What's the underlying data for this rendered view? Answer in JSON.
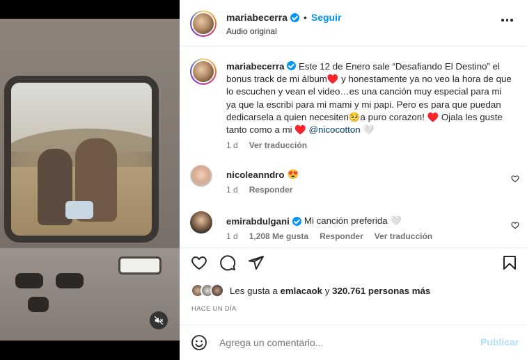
{
  "header": {
    "username": "mariabecerra",
    "separator": "•",
    "follow_label": "Seguir",
    "subtitle": "Audio original"
  },
  "caption": {
    "username": "mariabecerra",
    "text_1": "Este 12 de Enero sale “Desafiando El Destino” el bonus track de mi álbum♥️ y honestamente ya no veo la hora de que lo escuchen y vean el video…es una canción muy especial para mi ya que la escribi para mi mami y mi papi. Pero es para que puedan dedicarsela a quien necesiten🥺a puro corazon! ♥️ Ojala les guste tanto como a mi ♥️ ",
    "mention": "@nicocotton",
    "text_2": " 🤍",
    "time": "1 d",
    "translate_label": "Ver traducción"
  },
  "comments": [
    {
      "username": "nicoleanndro",
      "text": "😍",
      "time": "1 d",
      "reply_label": "Responder"
    },
    {
      "username": "emirabdulgani",
      "text": "Mi canción preferida 🤍",
      "time": "1 d",
      "likes": "1,208 Me gusta",
      "reply_label": "Responder",
      "translate_label": "Ver traducción"
    }
  ],
  "likes": {
    "prefix": "Les gusta a ",
    "user": "emlacaok",
    "middle": " y ",
    "count": "320.761 personas más"
  },
  "time_ago": "HACE UN DÍA",
  "composer": {
    "placeholder": "Agrega un comentario...",
    "publish_label": "Publicar"
  },
  "colors": {
    "accent": "#0095f6",
    "publish_disabled": "#b2dffc",
    "muted_text": "#737373"
  },
  "icons": [
    "mute-icon",
    "more-icon",
    "verified-icon",
    "heart-icon",
    "comment-icon",
    "share-icon",
    "bookmark-icon",
    "emoji-icon"
  ]
}
